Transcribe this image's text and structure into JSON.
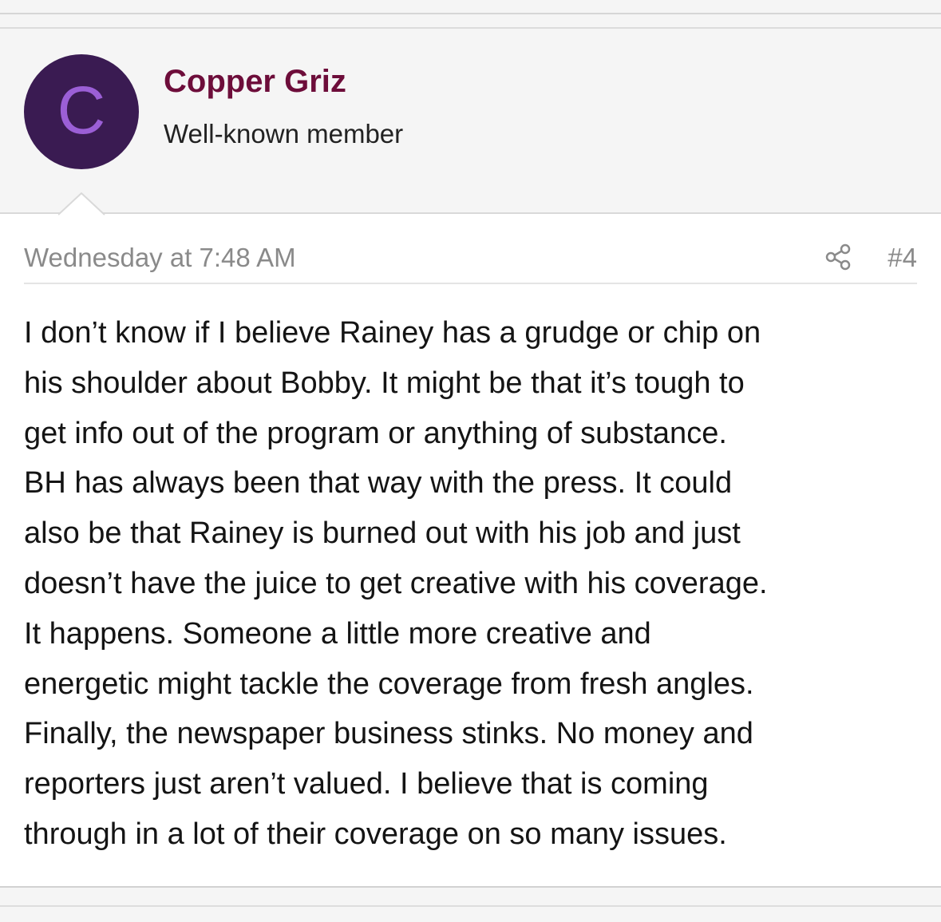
{
  "post": {
    "author": {
      "avatar_letter": "C",
      "avatar_bg": "#3a1b52",
      "avatar_letter_color": "#9b5fd6",
      "name": "Copper Griz",
      "name_color": "#6d0d3a",
      "title": "Well-known member"
    },
    "date": "Wednesday at 7:48 AM",
    "share_icon": "share-icon",
    "number": "#4",
    "message_lines": [
      "I don’t know if I believe Rainey has a grudge or chip on",
      "his shoulder about Bobby. It might be that it’s tough to",
      "get info out of the program or anything of substance.",
      "BH has always been that way with the press. It could",
      "also be that Rainey is burned out with his job and just",
      "doesn’t have the juice to get creative with his coverage.",
      "It happens. Someone a little more creative and",
      "energetic might tackle the coverage from fresh angles.",
      "Finally, the newspaper business stinks. No money and",
      "reporters just aren’t valued. I believe that is coming",
      "through in a lot of their coverage on so many issues."
    ]
  }
}
